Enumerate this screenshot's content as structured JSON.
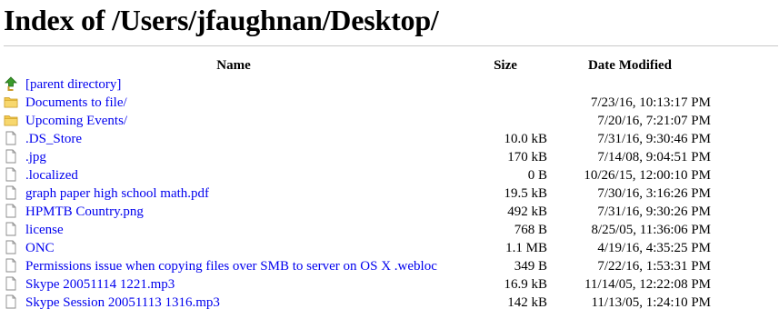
{
  "page": {
    "title": "Index of /Users/jfaughnan/Desktop/"
  },
  "columns": {
    "name": "Name",
    "size": "Size",
    "date": "Date Modified"
  },
  "entries": [
    {
      "name": "[parent directory]",
      "size": "",
      "date": "",
      "icon": "up-arrow-icon"
    },
    {
      "name": "Documents to file/",
      "size": "",
      "date": "7/23/16, 10:13:17 PM",
      "icon": "folder-icon"
    },
    {
      "name": "Upcoming Events/",
      "size": "",
      "date": "7/20/16, 7:21:07 PM",
      "icon": "folder-icon"
    },
    {
      "name": ".DS_Store",
      "size": "10.0 kB",
      "date": "7/31/16, 9:30:46 PM",
      "icon": "file-icon"
    },
    {
      "name": ".jpg",
      "size": "170 kB",
      "date": "7/14/08, 9:04:51 PM",
      "icon": "file-icon"
    },
    {
      "name": ".localized",
      "size": "0 B",
      "date": "10/26/15, 12:00:10 PM",
      "icon": "file-icon"
    },
    {
      "name": "graph paper high school math.pdf",
      "size": "19.5 kB",
      "date": "7/30/16, 3:16:26 PM",
      "icon": "file-icon"
    },
    {
      "name": "HPMTB Country.png",
      "size": "492 kB",
      "date": "7/31/16, 9:30:26 PM",
      "icon": "file-icon"
    },
    {
      "name": "license",
      "size": "768 B",
      "date": "8/25/05, 11:36:06 PM",
      "icon": "file-icon"
    },
    {
      "name": "ONC",
      "size": "1.1 MB",
      "date": "4/19/16, 4:35:25 PM",
      "icon": "file-icon"
    },
    {
      "name": "Permissions issue when copying files over SMB to server on OS X .webloc",
      "size": "349 B",
      "date": "7/22/16, 1:53:31 PM",
      "icon": "file-icon"
    },
    {
      "name": "Skype 20051114 1221.mp3",
      "size": "16.9 kB",
      "date": "11/14/05, 12:22:08 PM",
      "icon": "file-icon"
    },
    {
      "name": "Skype Session 20051113 1316.mp3",
      "size": "142 kB",
      "date": "11/13/05, 1:24:10 PM",
      "icon": "file-icon"
    }
  ],
  "colors": {
    "link": "#0000ee",
    "folder": "#f2c84b",
    "up_arrow": "#3a9a2a"
  }
}
